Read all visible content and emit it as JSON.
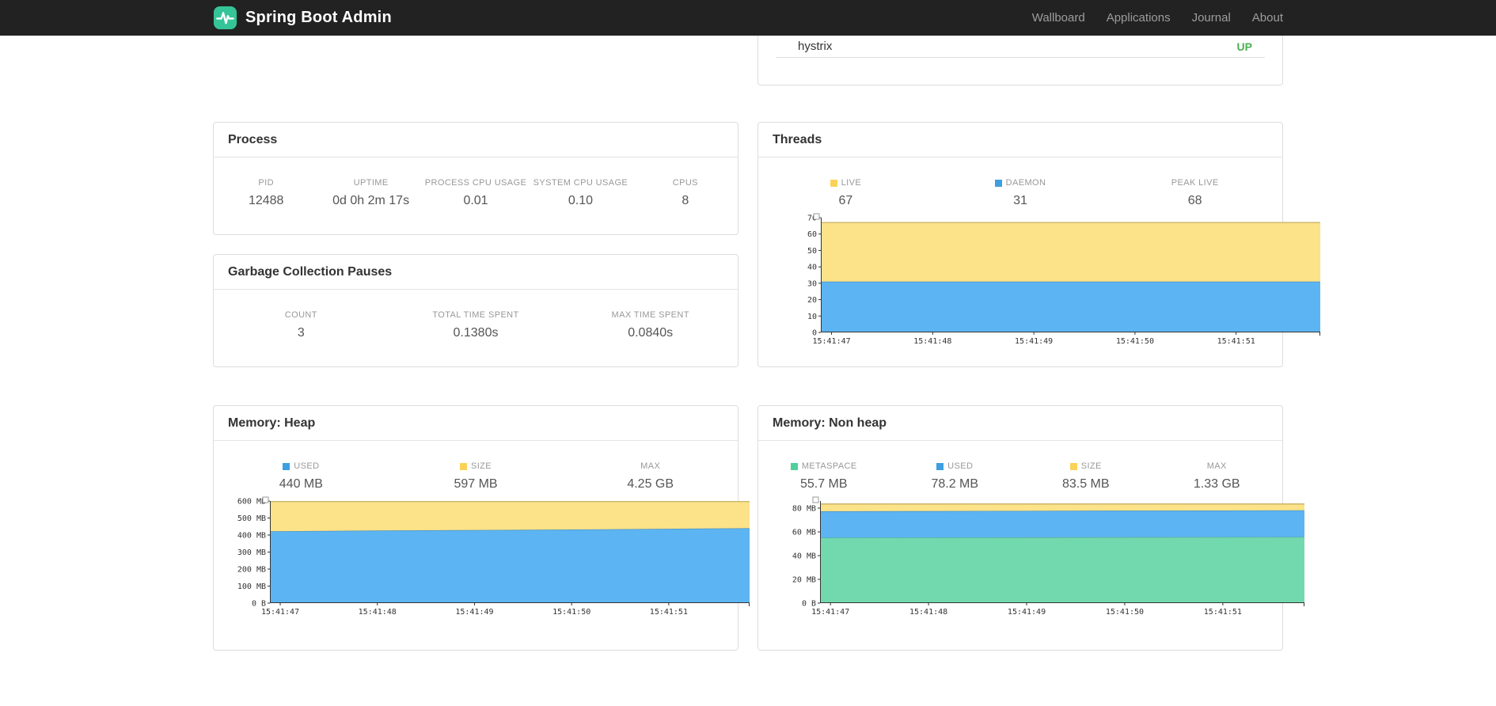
{
  "navbar": {
    "brand": "Spring Boot Admin",
    "links": [
      {
        "label": "Wallboard"
      },
      {
        "label": "Applications"
      },
      {
        "label": "Journal"
      },
      {
        "label": "About"
      }
    ]
  },
  "colors": {
    "navbar_bg": "#222222",
    "accent_green": "#35c498",
    "status_up": "#4caf50",
    "area_blue": "#5cb5f2",
    "area_yellow": "#fce288",
    "area_green": "#72d9ae",
    "swatch_blue": "#3d9fe0",
    "swatch_yellow": "#fbd258",
    "swatch_green": "#4ecf9c"
  },
  "health_panel": {
    "rows": [
      {
        "name": "hystrix",
        "status": "UP",
        "status_color": "#4caf50"
      }
    ]
  },
  "process": {
    "title": "Process",
    "metrics": [
      {
        "label": "PID",
        "value": "12488"
      },
      {
        "label": "UPTIME",
        "value": "0d 0h 2m 17s"
      },
      {
        "label": "PROCESS CPU USAGE",
        "value": "0.01"
      },
      {
        "label": "SYSTEM CPU USAGE",
        "value": "0.10"
      },
      {
        "label": "CPUS",
        "value": "8"
      }
    ]
  },
  "gc": {
    "title": "Garbage Collection Pauses",
    "metrics": [
      {
        "label": "COUNT",
        "value": "3"
      },
      {
        "label": "TOTAL TIME SPENT",
        "value": "0.1380s"
      },
      {
        "label": "MAX TIME SPENT",
        "value": "0.0840s"
      }
    ]
  },
  "threads": {
    "title": "Threads",
    "metrics": [
      {
        "label": "LIVE",
        "value": "67",
        "color": "#fbd258"
      },
      {
        "label": "DAEMON",
        "value": "31",
        "color": "#3d9fe0"
      },
      {
        "label": "PEAK LIVE",
        "value": "68"
      }
    ]
  },
  "heap": {
    "title": "Memory: Heap",
    "metrics": [
      {
        "label": "USED",
        "value": "440 MB",
        "color": "#3d9fe0"
      },
      {
        "label": "SIZE",
        "value": "597 MB",
        "color": "#fbd258"
      },
      {
        "label": "MAX",
        "value": "4.25 GB"
      }
    ]
  },
  "nonheap": {
    "title": "Memory: Non heap",
    "metrics": [
      {
        "label": "METASPACE",
        "value": "55.7 MB",
        "color": "#4ecf9c"
      },
      {
        "label": "USED",
        "value": "78.2 MB",
        "color": "#3d9fe0"
      },
      {
        "label": "SIZE",
        "value": "83.5 MB",
        "color": "#fbd258"
      },
      {
        "label": "MAX",
        "value": "1.33 GB"
      }
    ]
  },
  "chart_data": [
    {
      "id": "threads",
      "type": "area",
      "title": "Threads",
      "legend_position": "top",
      "grid": false,
      "x_labels": [
        "15:41:47",
        "15:41:48",
        "15:41:49",
        "15:41:50",
        "15:41:51"
      ],
      "y_ticks": [
        0,
        10,
        20,
        30,
        40,
        50,
        60,
        70
      ],
      "y_tick_labels": [
        "0",
        "10",
        "20",
        "30",
        "40",
        "50",
        "60",
        "70"
      ],
      "y_max": 70,
      "series": [
        {
          "name": "daemon",
          "color": "#5cb5f2",
          "values": [
            31,
            31,
            31,
            31,
            31,
            31
          ]
        },
        {
          "name": "live",
          "color": "#fce288",
          "values": [
            67,
            67,
            67,
            67,
            67,
            67
          ]
        }
      ]
    },
    {
      "id": "memory-heap",
      "type": "area",
      "title": "Memory: Heap",
      "legend_position": "top",
      "grid": false,
      "x_labels": [
        "15:41:47",
        "15:41:48",
        "15:41:49",
        "15:41:50",
        "15:41:51"
      ],
      "y_ticks": [
        0,
        100,
        200,
        300,
        400,
        500,
        600
      ],
      "y_tick_labels": [
        "0 B",
        "100 MB",
        "200 MB",
        "300 MB",
        "400 MB",
        "500 MB",
        "600 MB"
      ],
      "y_max": 600,
      "series": [
        {
          "name": "used",
          "color": "#5cb5f2",
          "values": [
            422,
            426,
            429,
            432,
            436,
            440
          ]
        },
        {
          "name": "size",
          "color": "#fce288",
          "values": [
            597,
            597,
            597,
            597,
            597,
            597
          ]
        }
      ]
    },
    {
      "id": "memory-nonheap",
      "type": "area",
      "title": "Memory: Non heap",
      "legend_position": "top",
      "grid": false,
      "x_labels": [
        "15:41:47",
        "15:41:48",
        "15:41:49",
        "15:41:50",
        "15:41:51"
      ],
      "y_ticks": [
        0,
        20,
        40,
        60,
        80
      ],
      "y_tick_labels": [
        "0 B",
        "20 MB",
        "40 MB",
        "60 MB",
        "80 MB"
      ],
      "y_max": 86,
      "series": [
        {
          "name": "metaspace",
          "color": "#72d9ae",
          "values": [
            55.1,
            55.2,
            55.3,
            55.5,
            55.6,
            55.7
          ]
        },
        {
          "name": "used",
          "color": "#5cb5f2",
          "values": [
            77.3,
            77.5,
            77.7,
            77.9,
            78.0,
            78.2
          ]
        },
        {
          "name": "size",
          "color": "#fce288",
          "values": [
            83.5,
            83.5,
            83.5,
            83.5,
            83.5,
            83.5
          ]
        }
      ]
    }
  ]
}
